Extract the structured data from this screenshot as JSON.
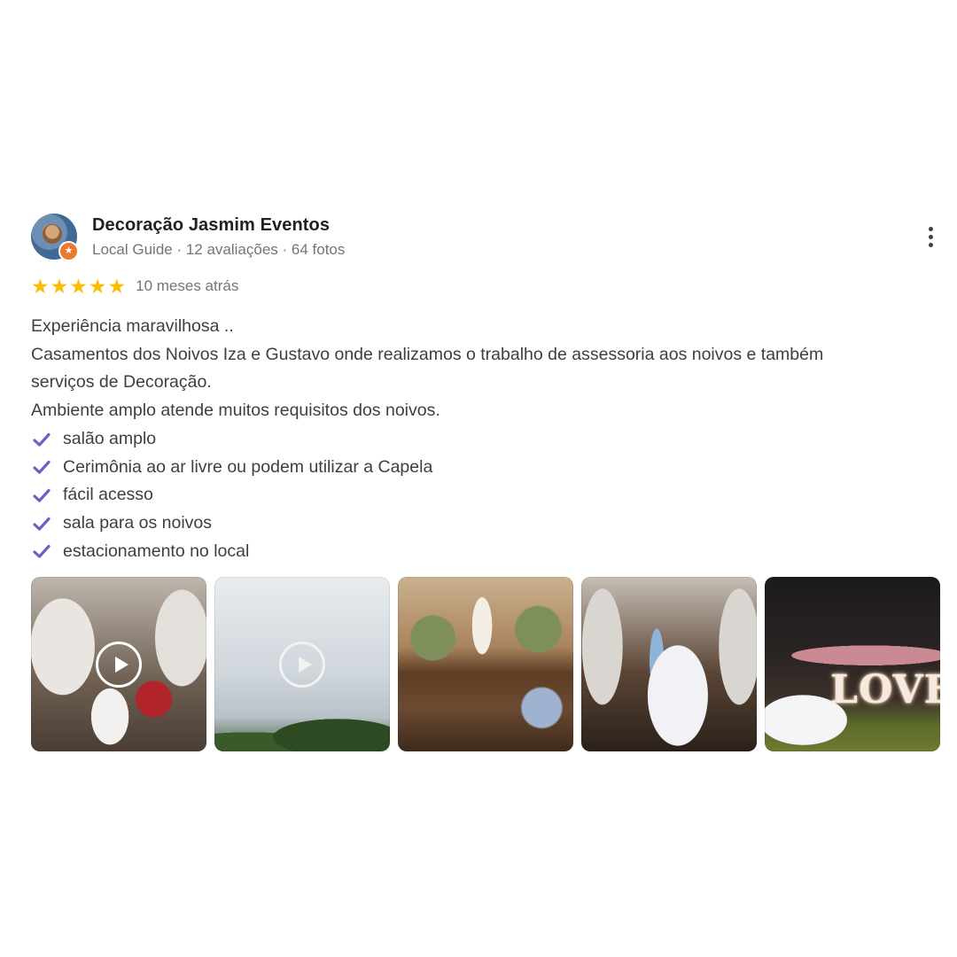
{
  "author": {
    "name": "Decoração Jasmim Eventos",
    "meta": "Local Guide · 12 avaliações · 64 fotos",
    "badge_icon": "star-icon"
  },
  "menu": {
    "icon": "more-vert-icon"
  },
  "rating": {
    "stars": 5,
    "max": 5,
    "time_ago": "10 meses atrás",
    "star_color": "#fbbc04"
  },
  "body": {
    "lines": [
      "Experiência maravilhosa ..",
      "Casamentos dos Noivos Iza e Gustavo onde realizamos o trabalho de assessoria aos noivos e também",
      "serviços de Decoração.",
      "Ambiente amplo atende muitos requisitos dos noivos."
    ],
    "checklist": [
      "salão amplo",
      "Cerimônia ao ar livre ou podem utilizar a Capela",
      "fácil acesso",
      "sala para os noivos",
      "estacionamento no local"
    ],
    "check_color": "#6c5fc7"
  },
  "photos": [
    {
      "kind": "video",
      "subject": "floral-arch-ceremony"
    },
    {
      "kind": "video",
      "subject": "cloudy-sky-trees"
    },
    {
      "kind": "photo",
      "subject": "cake-table"
    },
    {
      "kind": "photo",
      "subject": "couple-floral-arch"
    },
    {
      "kind": "photo",
      "subject": "love-letters-night",
      "letters": "LOVE"
    }
  ]
}
